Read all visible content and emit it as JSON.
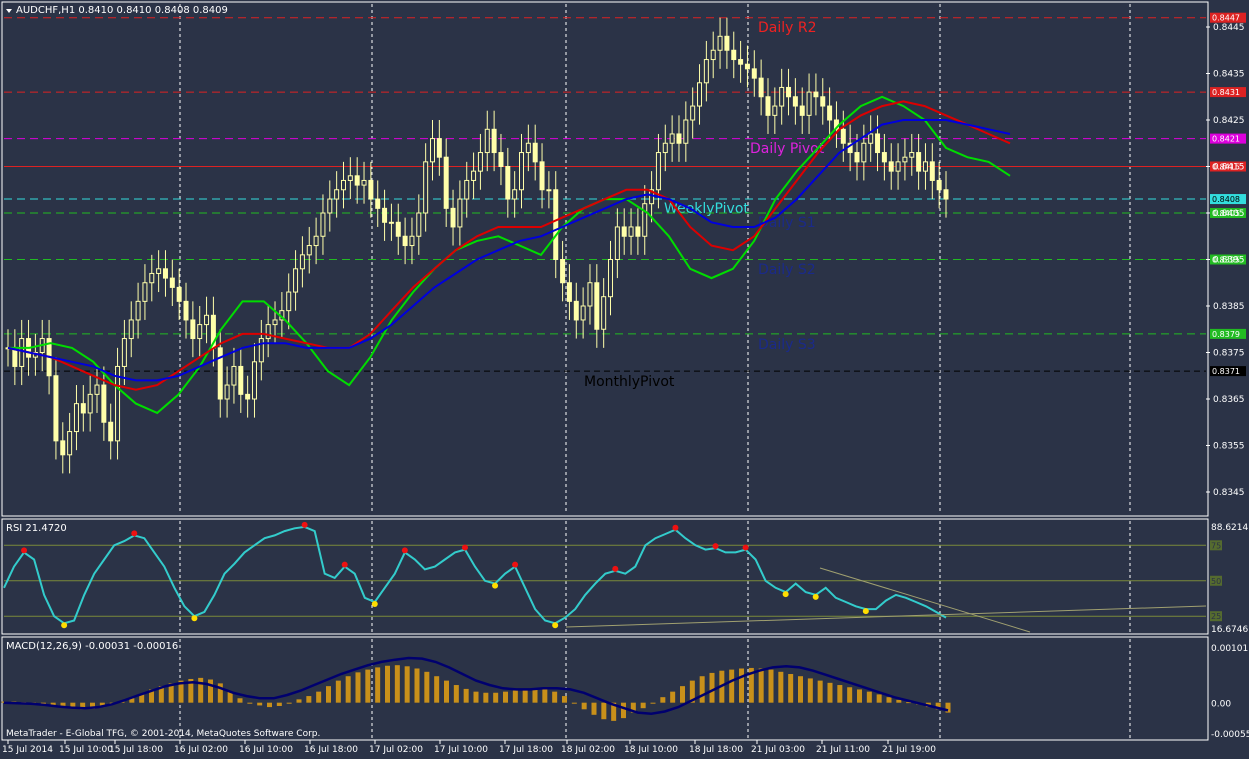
{
  "window": {
    "symbol_caption": "AUDCHF,H1  0.8410 0.8410 0.8408 0.8409",
    "footer": "MetaTrader - E-Global TFG, © 2001-2014, MetaQuotes Software Corp."
  },
  "colors": {
    "background": "#2b3347",
    "grid": "#ffffff",
    "candle_bull": "#ffffaa",
    "candle_bear": "#ffffaa",
    "ma_fast": "#00dd00",
    "ma_mid": "#dd0000",
    "ma_slow": "#0000dd",
    "rsi": "#33cccc",
    "macd_hist": "#c8901a",
    "macd_signal": "#00006e"
  },
  "chart_data": [
    {
      "type": "candlestick",
      "panel": "price",
      "ylim": [
        0.834,
        0.845
      ],
      "y_ticks": [
        "0.8445",
        "0.8435",
        "0.8425",
        "0.8415",
        "0.8405",
        "0.8395",
        "0.8385",
        "0.8375",
        "0.8365",
        "0.8355",
        "0.8345"
      ],
      "x_ticks": [
        "15 Jul 2014",
        "15 Jul 10:00",
        "15 Jul 18:00",
        "16 Jul 02:00",
        "16 Jul 10:00",
        "16 Jul 18:00",
        "17 Jul 02:00",
        "17 Jul 10:00",
        "17 Jul 18:00",
        "18 Jul 02:00",
        "18 Jul 10:00",
        "18 Jul 18:00",
        "21 Jul 03:00",
        "21 Jul 11:00",
        "21 Jul 19:00"
      ],
      "levels": [
        {
          "name": "Daily R2",
          "value": 0.8447,
          "label": "0.8447",
          "color": "#dd2222",
          "text_color": "#ee2222"
        },
        {
          "name": "",
          "value": 0.8431,
          "label": "0.8431",
          "color": "#dd2222",
          "text_color": ""
        },
        {
          "name": "",
          "value": 0.8421,
          "label": "0.8421",
          "color": "#dd00dd",
          "text_color": ""
        },
        {
          "name": "Daily Pivot",
          "value": 0.8415,
          "label": "0.8415",
          "color": "#dd2222",
          "text_color": "#dd22dd"
        },
        {
          "name": "WeeklyPivot",
          "value": 0.8408,
          "label": "0.8408",
          "color": "#33dddd",
          "text_color": "#33dddd"
        },
        {
          "name": "Daily S1",
          "value": 0.8405,
          "label": "0.8405",
          "color": "#22bb22",
          "text_color": "#1a2a8a"
        },
        {
          "name": "Daily S2",
          "value": 0.8395,
          "label": "0.8395",
          "color": "#22bb22",
          "text_color": "#1a2a8a"
        },
        {
          "name": "Daily S3",
          "value": 0.8379,
          "label": "0.8379",
          "color": "#22bb22",
          "text_color": "#1a2a8a"
        },
        {
          "name": "MonthlyPivot",
          "value": 0.8371,
          "label": "0.8371",
          "color": "#000000",
          "text_color": "#000000"
        }
      ],
      "ohlc_closes": [
        0.8376,
        0.8372,
        0.8378,
        0.8374,
        0.8375,
        0.8378,
        0.837,
        0.8356,
        0.8353,
        0.8358,
        0.8364,
        0.8362,
        0.8366,
        0.8368,
        0.836,
        0.8356,
        0.8372,
        0.8378,
        0.8382,
        0.8386,
        0.839,
        0.8392,
        0.8393,
        0.8391,
        0.8389,
        0.8386,
        0.8382,
        0.8378,
        0.8381,
        0.8383,
        0.8376,
        0.8365,
        0.8368,
        0.8372,
        0.8366,
        0.8365,
        0.8373,
        0.8378,
        0.8381,
        0.8382,
        0.8384,
        0.8388,
        0.8393,
        0.8396,
        0.8398,
        0.84,
        0.8405,
        0.8408,
        0.841,
        0.8412,
        0.8413,
        0.8411,
        0.8412,
        0.8408,
        0.8406,
        0.8403,
        0.8403,
        0.84,
        0.8398,
        0.84,
        0.8405,
        0.8416,
        0.8421,
        0.8417,
        0.8406,
        0.8402,
        0.8408,
        0.8412,
        0.8414,
        0.8418,
        0.8423,
        0.8418,
        0.8415,
        0.8408,
        0.841,
        0.8418,
        0.842,
        0.8416,
        0.841,
        0.841,
        0.8395,
        0.839,
        0.8386,
        0.8382,
        0.8385,
        0.839,
        0.838,
        0.8387,
        0.8395,
        0.8402,
        0.84,
        0.8402,
        0.84,
        0.8407,
        0.841,
        0.8418,
        0.842,
        0.8422,
        0.842,
        0.8425,
        0.8428,
        0.8433,
        0.8438,
        0.844,
        0.8443,
        0.844,
        0.8438,
        0.8437,
        0.8436,
        0.8434,
        0.843,
        0.8426,
        0.8428,
        0.8432,
        0.843,
        0.8428,
        0.8426,
        0.8431,
        0.843,
        0.8428,
        0.8425,
        0.8423,
        0.842,
        0.8418,
        0.8416,
        0.842,
        0.8422,
        0.8418,
        0.8416,
        0.8414,
        0.8416,
        0.8417,
        0.8418,
        0.8414,
        0.8416,
        0.8412,
        0.841,
        0.8408
      ],
      "series": [
        {
          "name": "",
          "values_note": "",
          "values": [
            0.8376,
            0.8376,
            0.8377,
            0.8376,
            0.8373,
            0.8368,
            0.8364,
            0.8362,
            0.8366,
            0.8372,
            0.838,
            0.8386,
            0.8386,
            0.8382,
            0.8377,
            0.8371,
            0.8368,
            0.8374,
            0.8382,
            0.8388,
            0.8393,
            0.8397,
            0.8399,
            0.84,
            0.8398,
            0.8396,
            0.8402,
            0.8406,
            0.8408,
            0.8408,
            0.8405,
            0.84,
            0.8393,
            0.8391,
            0.8393,
            0.8399,
            0.8408,
            0.8414,
            0.8419,
            0.8424,
            0.8428,
            0.843,
            0.8428,
            0.8425,
            0.8419,
            0.8417,
            0.8416,
            0.8413
          ]
        },
        {
          "name": "",
          "values": [
            0.8376,
            0.8375,
            0.8374,
            0.8372,
            0.837,
            0.8368,
            0.8367,
            0.8368,
            0.8371,
            0.8374,
            0.8377,
            0.8379,
            0.8379,
            0.8378,
            0.8377,
            0.8376,
            0.8376,
            0.8379,
            0.8384,
            0.8389,
            0.8393,
            0.8397,
            0.84,
            0.8402,
            0.8402,
            0.8402,
            0.8404,
            0.8406,
            0.8408,
            0.841,
            0.841,
            0.8408,
            0.8402,
            0.8398,
            0.8397,
            0.84,
            0.8406,
            0.8412,
            0.8418,
            0.8423,
            0.8426,
            0.8428,
            0.8429,
            0.8428,
            0.8426,
            0.8424,
            0.8422,
            0.842
          ]
        },
        {
          "name": "",
          "values": [
            0.8376,
            0.8375,
            0.8374,
            0.8373,
            0.8372,
            0.837,
            0.8369,
            0.8369,
            0.837,
            0.8372,
            0.8374,
            0.8376,
            0.8377,
            0.8377,
            0.8376,
            0.8376,
            0.8376,
            0.8378,
            0.8381,
            0.8385,
            0.8389,
            0.8392,
            0.8395,
            0.8397,
            0.8399,
            0.84,
            0.8402,
            0.8404,
            0.8406,
            0.8408,
            0.8409,
            0.8408,
            0.8406,
            0.8403,
            0.8402,
            0.8402,
            0.8404,
            0.8408,
            0.8413,
            0.8418,
            0.8421,
            0.8424,
            0.8425,
            0.8425,
            0.8425,
            0.8424,
            0.8423,
            0.8422
          ]
        }
      ]
    },
    {
      "type": "line",
      "panel": "rsi",
      "title": "RSI 21.4720",
      "ylim": [
        16.6746,
        88.6214
      ],
      "y_ticks": [
        "88.6214",
        "16.6746"
      ],
      "levels": [
        {
          "label": "75",
          "value": 75
        },
        {
          "label": "50",
          "value": 50
        },
        {
          "label": "25",
          "value": 25
        }
      ],
      "values": [
        45,
        60,
        70,
        65,
        40,
        25,
        20,
        22,
        40,
        55,
        65,
        75,
        78,
        82,
        80,
        70,
        60,
        45,
        32,
        25,
        28,
        40,
        55,
        62,
        70,
        75,
        80,
        82,
        85,
        87,
        88,
        85,
        55,
        52,
        60,
        55,
        38,
        35,
        45,
        55,
        70,
        65,
        58,
        60,
        65,
        70,
        72,
        60,
        50,
        48,
        55,
        60,
        45,
        30,
        22,
        20,
        24,
        30,
        40,
        48,
        55,
        57,
        55,
        60,
        75,
        80,
        83,
        86,
        80,
        75,
        72,
        73,
        70,
        70,
        72,
        65,
        50,
        45,
        42,
        48,
        42,
        40,
        45,
        38,
        35,
        32,
        30,
        30,
        36,
        40,
        38,
        35,
        32,
        28,
        24
      ]
    },
    {
      "type": "bar",
      "panel": "macd",
      "title": "MACD(12,26,9) -0.00031 -0.00016",
      "ylim": [
        -0.0005,
        0.001
      ],
      "y_ticks": [
        "0.00101",
        "0.00",
        "-0.00055"
      ],
      "series": [
        {
          "name": "",
          "kind": "histogram",
          "values": [
            2e-05,
            2e-05,
            1e-05,
            0.0,
            -3e-05,
            -5e-05,
            -8e-05,
            -0.0001,
            -0.00012,
            -0.00011,
            -8e-05,
            -3e-05,
            2e-05,
            8e-05,
            0.00016,
            0.00024,
            0.0003,
            0.00035,
            0.0004,
            0.00043,
            0.00045,
            0.00042,
            0.00035,
            0.0002,
            8e-05,
            0.0,
            -5e-05,
            -8e-05,
            -6e-05,
            0.0,
            6e-05,
            0.00012,
            0.0002,
            0.0003,
            0.0004,
            0.00048,
            0.00055,
            0.0006,
            0.00064,
            0.00067,
            0.00068,
            0.00066,
            0.00062,
            0.00056,
            0.00048,
            0.0004,
            0.00032,
            0.00025,
            0.0002,
            0.00018,
            0.00018,
            0.0002,
            0.00022,
            0.00024,
            0.00026,
            0.00025,
            0.0002,
            0.00012,
            0.0,
            -0.00012,
            -0.00022,
            -0.0003,
            -0.00033,
            -0.00028,
            -0.00018,
            -0.0001,
            0.0,
            0.0001,
            0.0002,
            0.0003,
            0.0004,
            0.00048,
            0.00054,
            0.00058,
            0.0006,
            0.00062,
            0.00063,
            0.00062,
            0.0006,
            0.00056,
            0.00052,
            0.00048,
            0.00044,
            0.0004,
            0.00036,
            0.00032,
            0.00028,
            0.00024,
            0.0002,
            0.00015,
            0.0001,
            5e-05,
            1e-05,
            -3e-05,
            -8e-05,
            -0.00012,
            -0.00018
          ]
        },
        {
          "name": "",
          "kind": "signal",
          "values": [
            0.0,
            -1e-05,
            -2e-05,
            -4e-05,
            -7e-05,
            -9e-05,
            -0.0001,
            -8e-05,
            -3e-05,
            5e-05,
            0.00014,
            0.00022,
            0.0003,
            0.00035,
            0.00037,
            0.00034,
            0.00027,
            0.00018,
            0.00012,
            8e-05,
            8e-05,
            0.00014,
            0.00022,
            0.00032,
            0.00042,
            0.00052,
            0.0006,
            0.00068,
            0.00074,
            0.00078,
            0.00081,
            0.0008,
            0.00074,
            0.00064,
            0.00052,
            0.0004,
            0.00032,
            0.00026,
            0.00024,
            0.00024,
            0.00026,
            0.00026,
            0.00024,
            0.00018,
            8e-05,
            -2e-05,
            -0.0001,
            -0.00018,
            -0.0002,
            -0.00016,
            -8e-05,
            4e-05,
            0.00016,
            0.00028,
            0.0004,
            0.0005,
            0.00058,
            0.00064,
            0.00066,
            0.00064,
            0.00058,
            0.0005,
            0.00042,
            0.00034,
            0.00026,
            0.00018,
            0.0001,
            4e-05,
            -2e-05,
            -8e-05,
            -0.00014
          ]
        }
      ]
    }
  ]
}
